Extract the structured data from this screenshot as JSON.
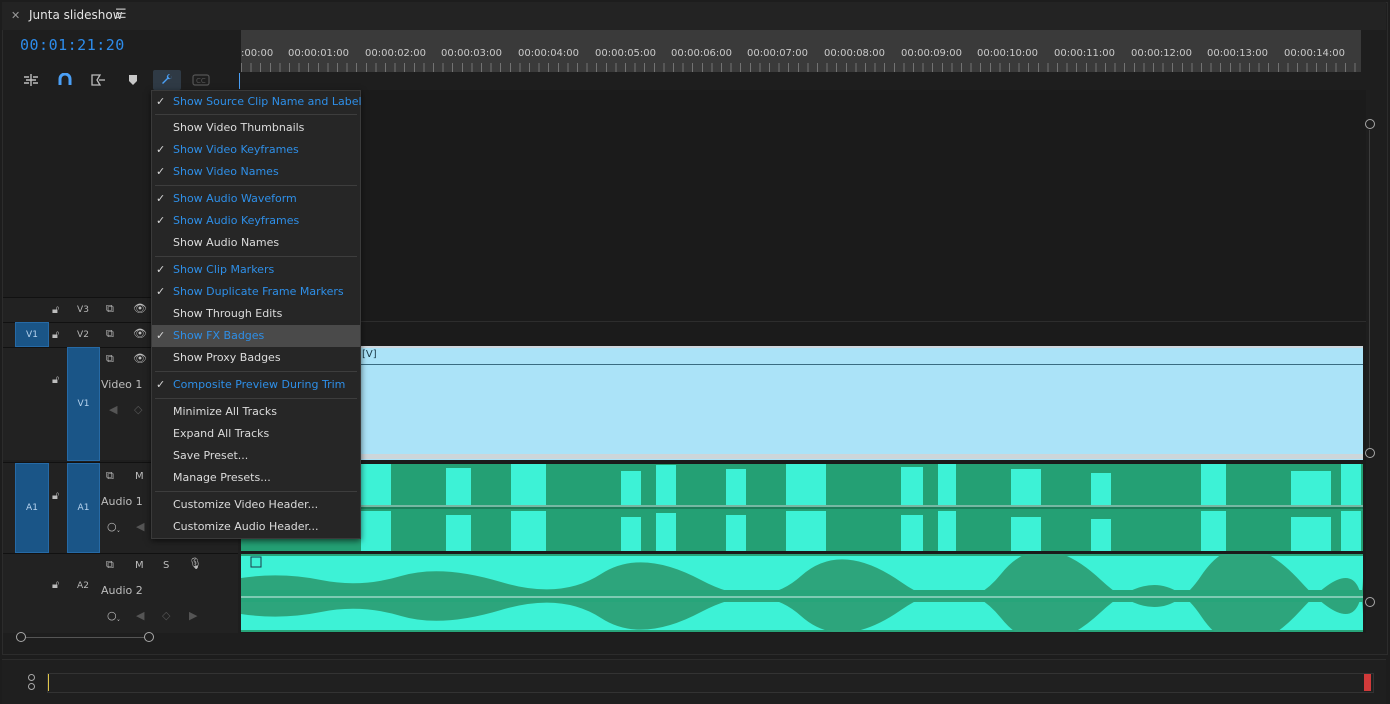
{
  "panel": {
    "title": "Junta slideshow",
    "timecode": "00:01:21:20"
  },
  "ruler": {
    "labels": [
      ":00:00",
      "00:00:01:00",
      "00:00:02:00",
      "00:00:03:00",
      "00:00:04:00",
      "00:00:05:00",
      "00:00:06:00",
      "00:00:07:00",
      "00:00:08:00",
      "00:00:09:00",
      "00:00:10:00",
      "00:00:11:00",
      "00:00:12:00",
      "00:00:13:00",
      "00:00:14:00"
    ]
  },
  "tracks": {
    "v3": {
      "label": "V3"
    },
    "v2": {
      "label": "V2",
      "source": "V1"
    },
    "v1": {
      "label": "V1",
      "name": "Video 1"
    },
    "a1": {
      "label": "A1",
      "source": "A1",
      "name": "Audio 1",
      "mute": "M"
    },
    "a2": {
      "label": "A2",
      "name": "Audio 2",
      "mute": "M",
      "solo": "S"
    }
  },
  "clips": {
    "v1_label": "[V]"
  },
  "menu": {
    "items": [
      {
        "label": "Show Source Clip Name and Label",
        "checked": true
      },
      {
        "label": "Show Video Thumbnails",
        "checked": false
      },
      {
        "label": "Show Video Keyframes",
        "checked": true
      },
      {
        "label": "Show Video Names",
        "checked": true
      },
      {
        "label": "Show Audio Waveform",
        "checked": true
      },
      {
        "label": "Show Audio Keyframes",
        "checked": true
      },
      {
        "label": "Show Audio Names",
        "checked": false
      },
      {
        "label": "Show Clip Markers",
        "checked": true
      },
      {
        "label": "Show Duplicate Frame Markers",
        "checked": true
      },
      {
        "label": "Show Through Edits",
        "checked": false
      },
      {
        "label": "Show FX Badges",
        "checked": true
      },
      {
        "label": "Show Proxy Badges",
        "checked": false
      },
      {
        "label": "Composite Preview During Trim",
        "checked": true
      },
      {
        "label": "Minimize All Tracks",
        "checked": false
      },
      {
        "label": "Expand All Tracks",
        "checked": false
      },
      {
        "label": "Save Preset...",
        "checked": false
      },
      {
        "label": "Manage Presets...",
        "checked": false
      },
      {
        "label": "Customize Video Header...",
        "checked": false
      },
      {
        "label": "Customize Audio Header...",
        "checked": false
      }
    ],
    "check_glyph": "✓"
  },
  "colors": {
    "accent": "#2d8ceb",
    "video_clip": "#abe3f8",
    "audio_clip": "#24a074",
    "waveform": "#3df2d6"
  }
}
